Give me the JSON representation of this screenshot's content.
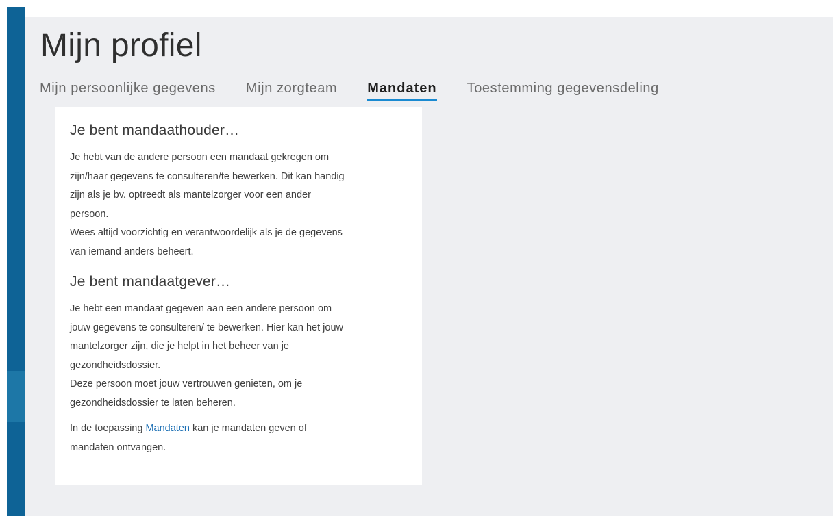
{
  "page_title": "Mijn profiel",
  "tabs": [
    {
      "label": "Mijn persoonlijke gegevens"
    },
    {
      "label": "Mijn zorgteam"
    },
    {
      "label": "Mandaten"
    },
    {
      "label": "Toestemming gegevensdeling"
    }
  ],
  "active_tab": "Mandaten",
  "card": {
    "section1": {
      "title": "Je bent mandaathouder…",
      "text": "Je hebt van de andere persoon een mandaat gekregen om\nzijn/haar gegevens te consulteren/te bewerken. Dit kan handig\nzijn als je bv. optreedt als mantelzorger voor een ander\npersoon.\nWees altijd voorzichtig en verantwoordelijk als je de gegevens\nvan iemand anders beheert."
    },
    "section2": {
      "title": "Je bent mandaatgever…",
      "text": "Je hebt een mandaat gegeven aan een andere persoon om\njouw gegevens te consulteren/ te bewerken. Hier kan het jouw\nmantelzorger zijn, die je helpt in het beheer van je\ngezondheidsdossier.\nDeze persoon moet jouw vertrouwen genieten, om je\ngezondheidsdossier te laten beheren."
    },
    "note": {
      "prefix": "In de toepassing ",
      "link": "Mandaten",
      "suffix": " kan je mandaten geven of\nmandaten ontvangen."
    }
  },
  "colors": {
    "sidebar": "#0e6396",
    "accent": "#1a8ad1",
    "link": "#1c6fb4",
    "background": "#eeeff2"
  }
}
